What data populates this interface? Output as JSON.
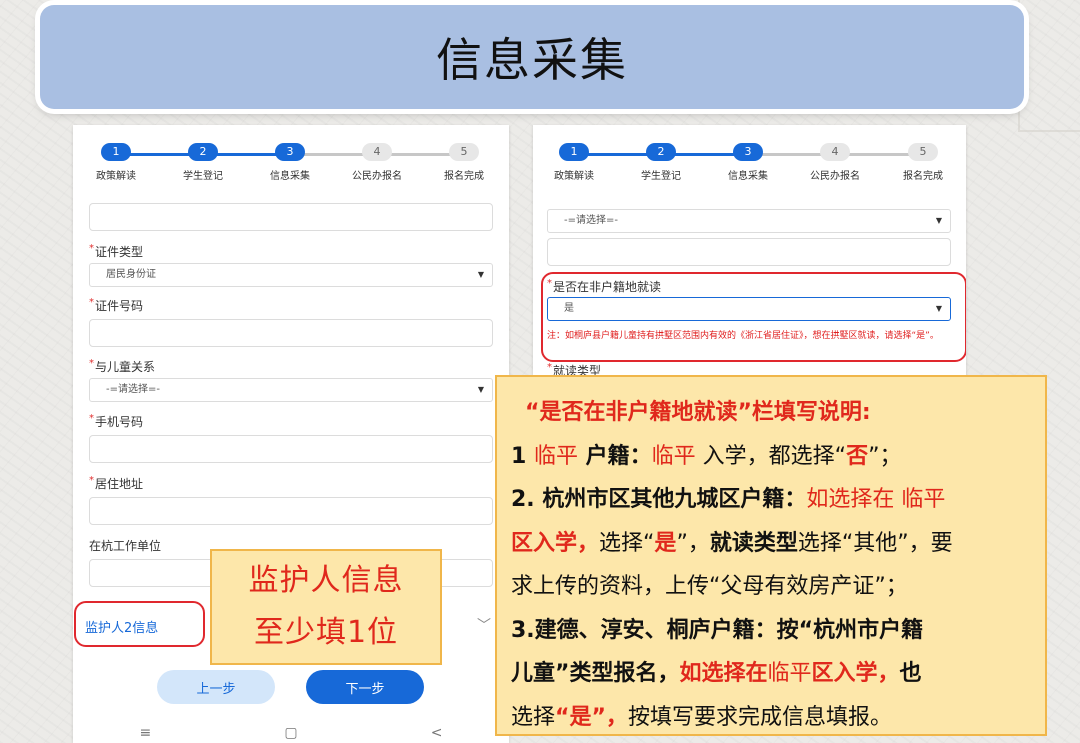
{
  "banner": {
    "title": "信息采集"
  },
  "steps": [
    {
      "num": "1",
      "label": "政策解读",
      "active": true
    },
    {
      "num": "2",
      "label": "学生登记",
      "active": true
    },
    {
      "num": "3",
      "label": "信息采集",
      "active": true
    },
    {
      "num": "4",
      "label": "公民办报名",
      "active": false
    },
    {
      "num": "5",
      "label": "报名完成",
      "active": false
    }
  ],
  "left_form": {
    "id_type_label": "证件类型",
    "id_type_value": "居民身份证",
    "id_number_label": "证件号码",
    "relation_label": "与儿童关系",
    "relation_value": "-=请选择=-",
    "phone_label": "手机号码",
    "address_label": "居住地址",
    "work_unit_label": "在杭工作单位",
    "guardian2_label": "监护人2信息",
    "prev_button": "上一步",
    "next_button": "下一步",
    "nav_menu": "≡",
    "nav_home": "▢",
    "nav_back": "<"
  },
  "right_form": {
    "top_select_value": "-=请选择=-",
    "nonlocal_label": "是否在非户籍地就读",
    "nonlocal_value": "是",
    "note": "注：如桐庐县户籍儿童持有拱墅区范围内有效的《浙江省居住证》，想在拱墅区就读，请选择“是”。",
    "study_type_label": "就读类型"
  },
  "callout_left": {
    "line1": "监护人信息",
    "line2": "至少填1位"
  },
  "callout_right": {
    "title": "“是否在非户籍地就读”栏填写说明:",
    "l1_a": "1 ",
    "l1_b": "临平",
    "l1_c": " 户籍：",
    "l1_d": "临平",
    "l1_e": " 入学，都选择“",
    "l1_f": "否",
    "l1_g": "”；",
    "l2_a": "2. 杭州市区其他九城区户籍：",
    "l2_b": "如选择在 临平",
    "l3_a": "区入学，",
    "l3_b": "选择“",
    "l3_c": "是",
    "l3_d": "”，",
    "l3_e": "就读类型",
    "l3_f": "选择“其他”，要",
    "l4": "求上传的资料，上传“父母有效房产证”；",
    "l5_a": "3.建德、淳安、桐庐户籍：",
    "l5_b": "按“杭州市户籍",
    "l6_a": "儿童”类型报名，",
    "l6_b": "如选择在",
    "l6_c": "临平",
    "l6_d": "区入学，",
    "l6_e": "也",
    "l7_a": "选择",
    "l7_b": "“是”，",
    "l7_c": "按填写要求完成信息填报。"
  }
}
